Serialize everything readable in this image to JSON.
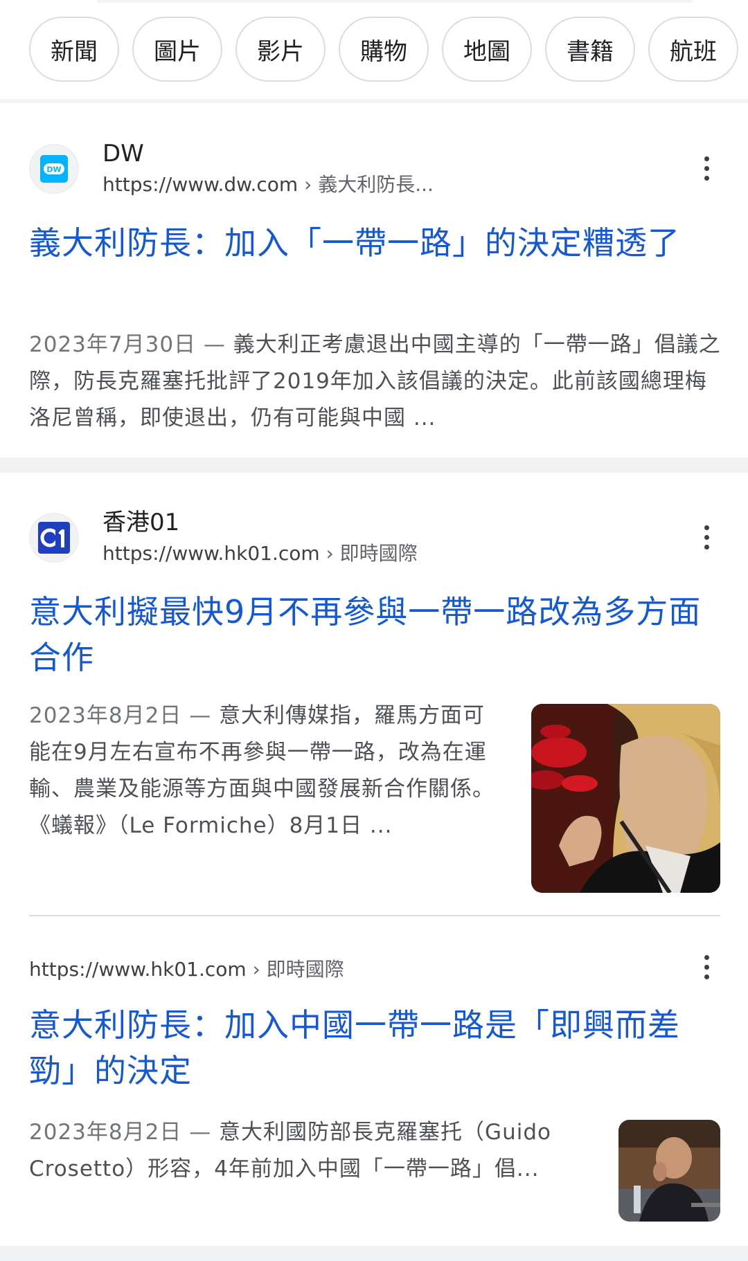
{
  "chips": [
    "新聞",
    "圖片",
    "影片",
    "購物",
    "地圖",
    "書籍",
    "航班"
  ],
  "results": [
    {
      "site_name": "DW",
      "url": "https://www.dw.com",
      "crumb": " › 義大利防長...",
      "favicon": "dw-logo-icon",
      "title": "義大利防長：加入「一帶一路」的決定糟透了",
      "date": "2023年7月30日 — ",
      "snippet": "義大利正考慮退出中國主導的「一帶一路」倡議之際，防長克羅塞托批評了2019年加入該倡議的決定。此前該國總理梅洛尼曾稱，即使退出，仍有可能與中國 ..."
    },
    {
      "site_name": "香港01",
      "url": "https://www.hk01.com",
      "crumb": " › 即時國際",
      "favicon": "hk01-logo-icon",
      "title": "意大利擬最快9月不再參與一帶一路改為多方面合作",
      "date": "2023年8月2日 — ",
      "snippet": "意大利傳媒指，羅馬方面可能在9月左右宣布不再參與一帶一路，改為在運輸、農業及能源等方面與中國發展新合作關係。《蟻報》（Le Formiche）8月1日 ..."
    },
    {
      "url": "https://www.hk01.com",
      "crumb": " › 即時國際",
      "title": "意大利防長：加入中國一帶一路是「即興而差勁」的決定",
      "date": "2023年8月2日 — ",
      "snippet": "意大利國防部長克羅塞托（Guido Crosetto）形容，4年前加入中國「一帶一路」倡..."
    }
  ],
  "colors": {
    "link": "#1558d6",
    "dw_blue": "#05b2fc",
    "hk01_blue": "#1f3fbf"
  }
}
